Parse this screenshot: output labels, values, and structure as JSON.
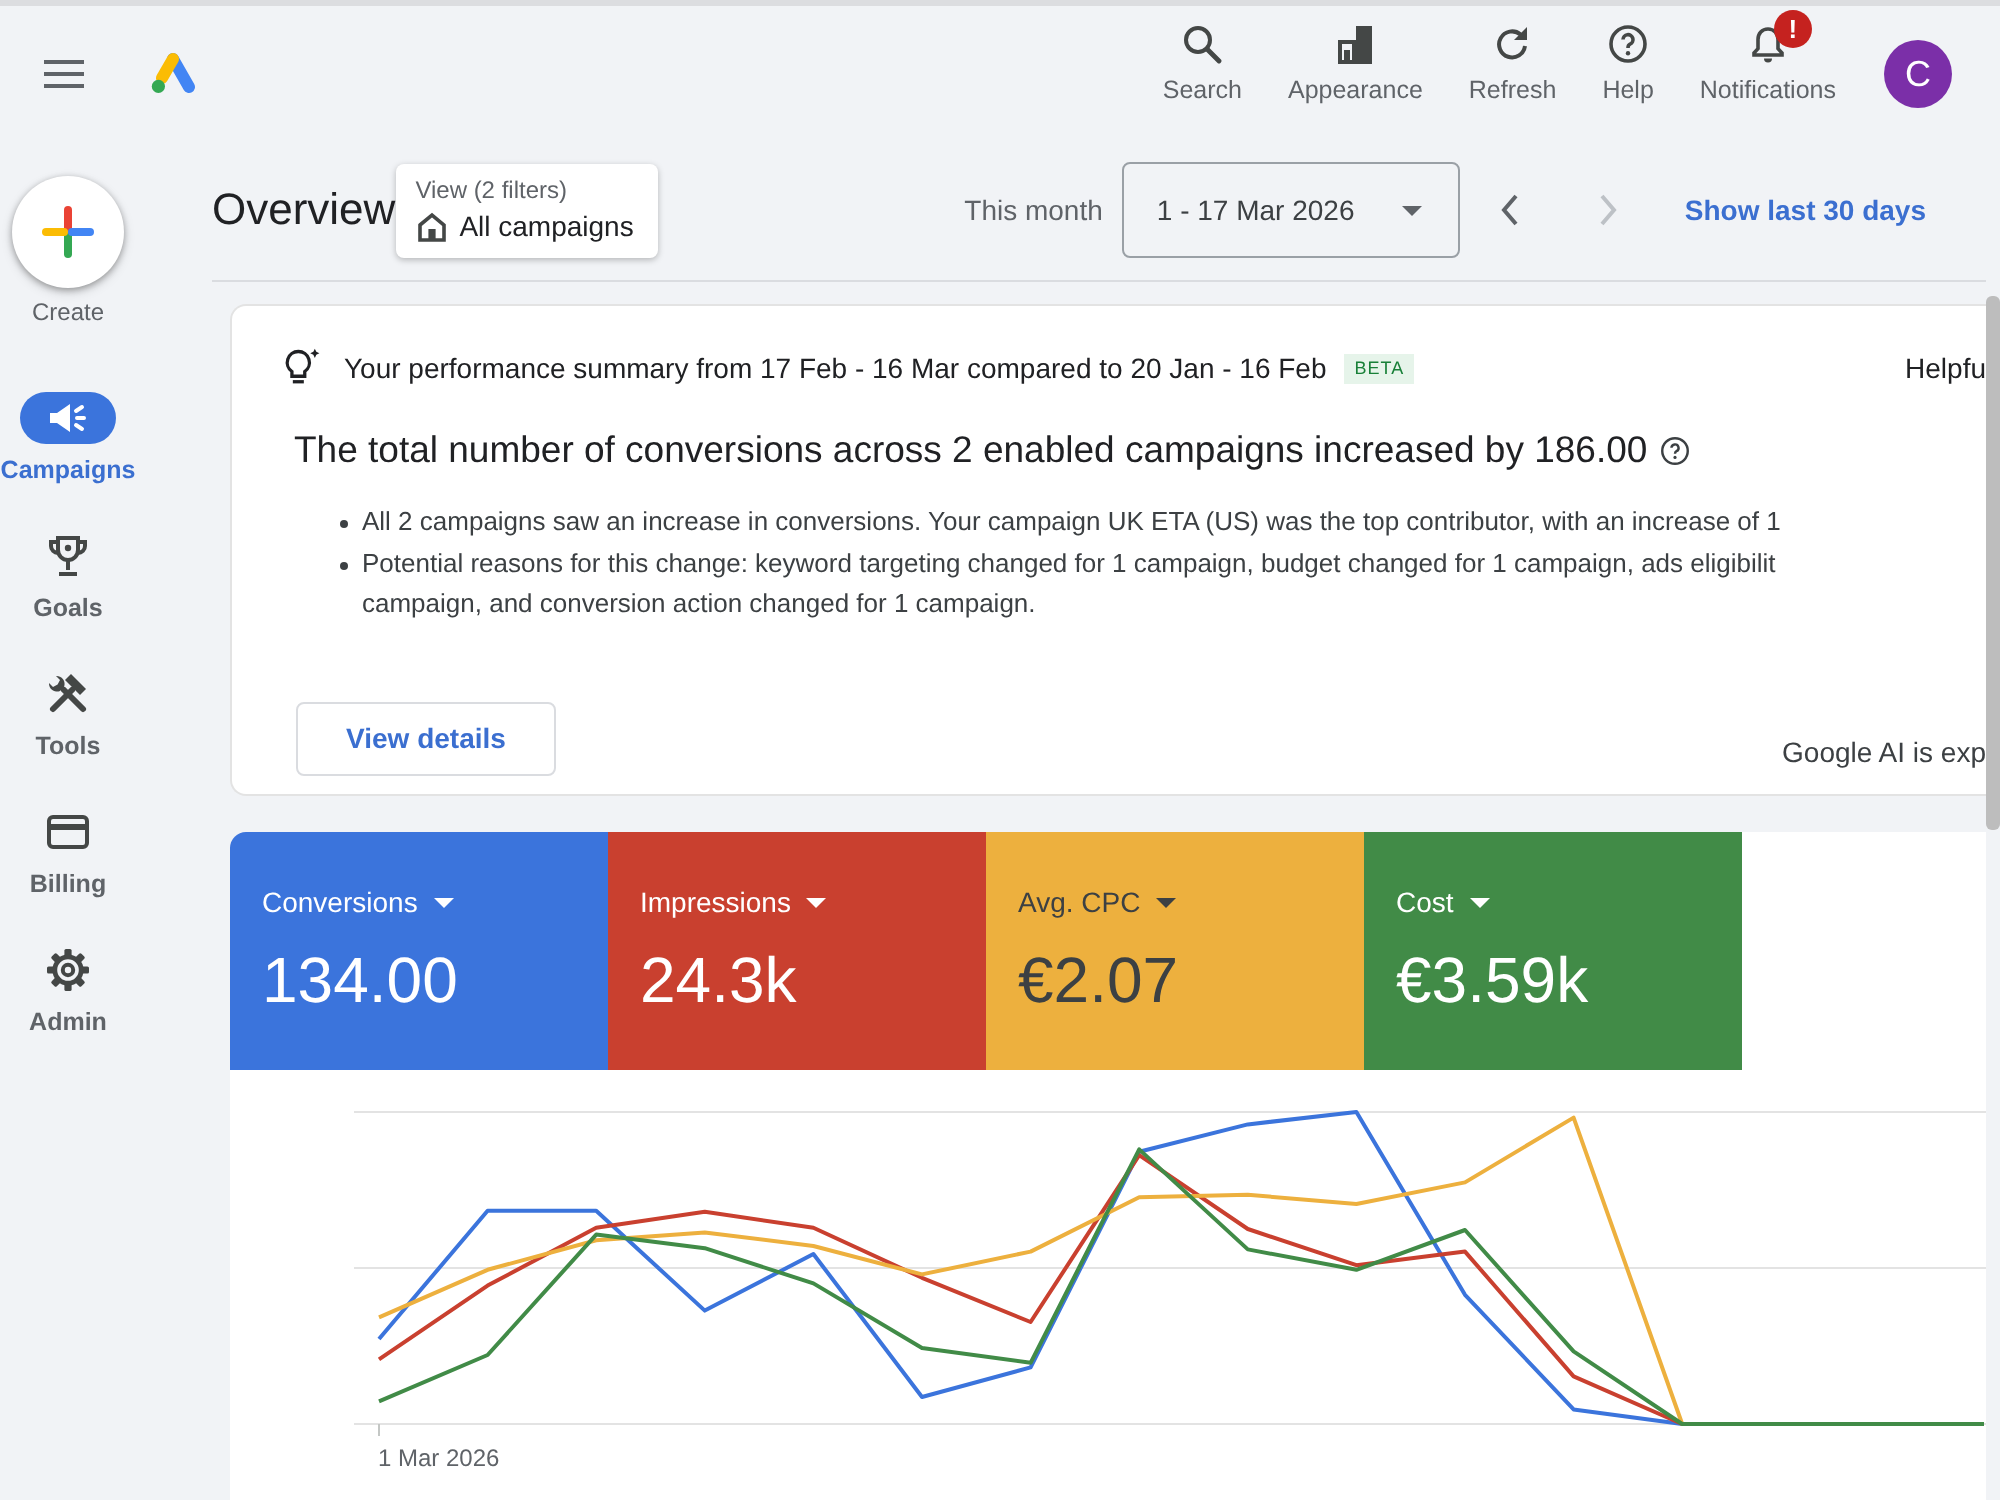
{
  "top_bar": {
    "actions": [
      {
        "label": "Search"
      },
      {
        "label": "Appearance"
      },
      {
        "label": "Refresh"
      },
      {
        "label": "Help"
      },
      {
        "label": "Notifications",
        "badge": "!"
      }
    ],
    "avatar": "C"
  },
  "sidebar": {
    "create": {
      "label": "Create"
    },
    "items": [
      {
        "label": "Campaigns",
        "selected": true
      },
      {
        "label": "Goals",
        "selected": false
      },
      {
        "label": "Tools",
        "selected": false
      },
      {
        "label": "Billing",
        "selected": false
      },
      {
        "label": "Admin",
        "selected": false
      }
    ]
  },
  "header": {
    "title": "Overview",
    "view_filter": {
      "caption": "View (2 filters)",
      "value": "All campaigns"
    },
    "period_label": "This month",
    "date_range": "1 - 17 Mar 2026",
    "nav": [
      {
        "kind": "previous",
        "disabled": false
      },
      {
        "kind": "next",
        "disabled": true
      }
    ],
    "link": "Show last 30 days"
  },
  "summary": {
    "title": "Your performance summary from 17 Feb - 16 Mar compared to 20 Jan - 16 Feb",
    "badge": "BETA",
    "feedback": "Helpfu",
    "headline": "The total number of conversions across 2 enabled campaigns increased by 186.00",
    "bullets": [
      {
        "lines": [
          "All 2 campaigns saw an increase in conversions. Your campaign UK ETA (US) was the top contributor, with an increase of 1"
        ]
      },
      {
        "lines": [
          "Potential reasons for this change: keyword targeting changed for 1 campaign, budget changed for 1 campaign, ads eligibilit",
          "campaign, and conversion action changed for 1 campaign."
        ]
      }
    ],
    "button": "View details",
    "footer": "Google AI is exp"
  },
  "metrics": [
    {
      "label": "Conversions",
      "value": "134.00",
      "color": "#3b74dc",
      "selected": true
    },
    {
      "label": "Impressions",
      "value": "24.3k",
      "color": "#c9402f",
      "selected": true
    },
    {
      "label": "Avg. CPC",
      "value": "€2.07",
      "color": "#edb03e",
      "selected": true
    },
    {
      "label": "Cost",
      "value": "€3.59k",
      "color": "#418b47",
      "selected": true
    }
  ],
  "chart": {
    "x_label": "1 Mar 2026"
  }
}
